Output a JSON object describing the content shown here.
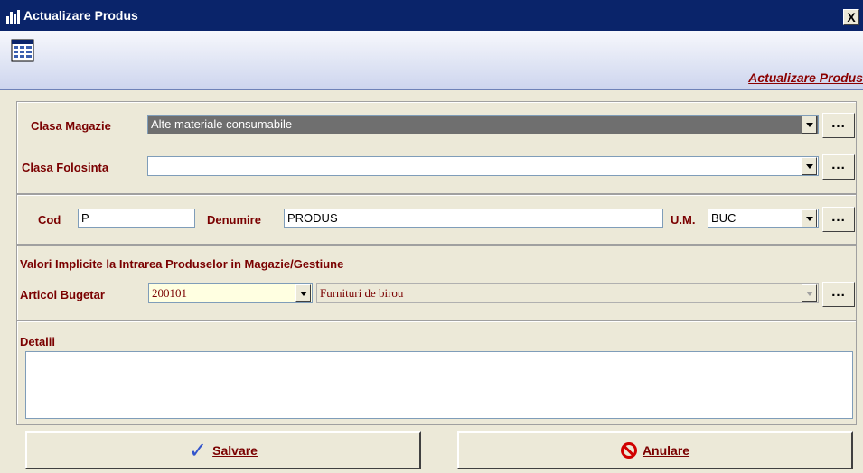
{
  "window": {
    "title": "Actualizare Produs",
    "close": "X"
  },
  "header": {
    "title": "Actualizare Produs"
  },
  "clasa": {
    "magazie_label": "Clasa Magazie",
    "magazie_value": "Alte materiale consumabile",
    "folosinta_label": "Clasa Folosinta",
    "folosinta_value": ""
  },
  "produs": {
    "cod_label": "Cod",
    "cod_value": "P",
    "denumire_label": "Denumire",
    "denumire_value": "PRODUS",
    "um_label": "U.M.",
    "um_value": "BUC"
  },
  "valori": {
    "section_title": "Valori Implicite la Intrarea Produselor in Magazie/Gestiune",
    "articol_label": "Articol Bugetar",
    "articol_code": "200101",
    "articol_name": "Furnituri de birou"
  },
  "detalii": {
    "label": "Detalii",
    "value": ""
  },
  "buttons": {
    "ellipsis": "...",
    "save": "Salvare",
    "cancel": "Anulare"
  },
  "icons": {
    "check": "✓"
  }
}
